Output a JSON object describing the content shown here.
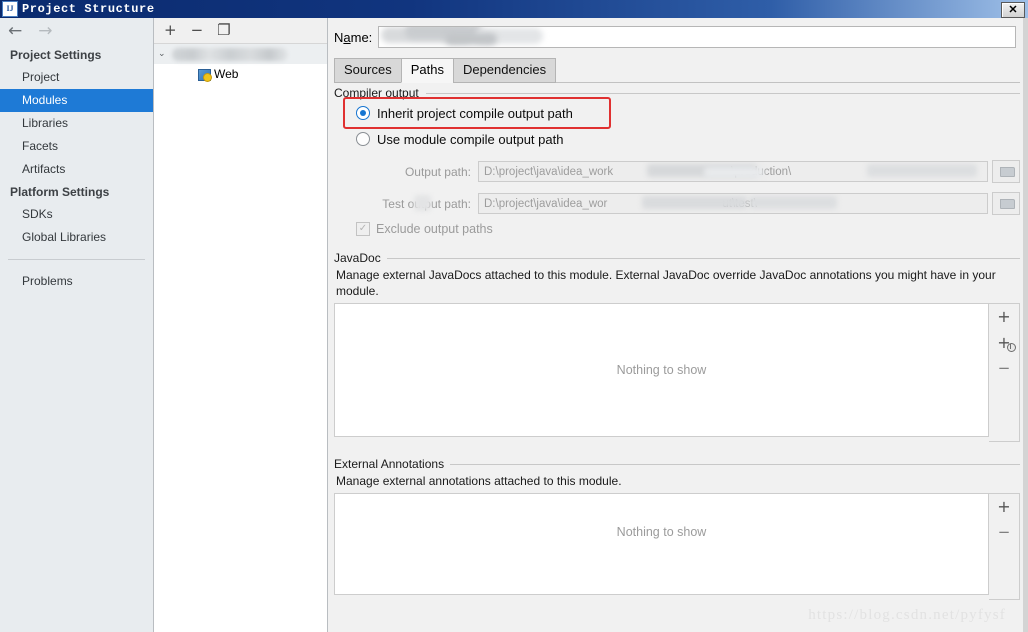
{
  "window": {
    "title": "Project Structure",
    "app_icon_text": "IJ",
    "close_label": "✕"
  },
  "sidebar": {
    "back_arrow": "←",
    "forward_arrow": "→",
    "groups": [
      {
        "title": "Project Settings",
        "items": [
          {
            "label": "Project",
            "selected": false
          },
          {
            "label": "Modules",
            "selected": true
          },
          {
            "label": "Libraries",
            "selected": false
          },
          {
            "label": "Facets",
            "selected": false
          },
          {
            "label": "Artifacts",
            "selected": false
          }
        ]
      },
      {
        "title": "Platform Settings",
        "items": [
          {
            "label": "SDKs",
            "selected": false
          },
          {
            "label": "Global Libraries",
            "selected": false
          }
        ]
      }
    ],
    "footer_item": "Problems"
  },
  "tree": {
    "toolbar": {
      "add": "+",
      "remove": "−",
      "copy": "❐"
    },
    "module_row": {
      "chevron": "⌄",
      "name_redacted": true
    },
    "child_row": {
      "label": "Web"
    }
  },
  "main": {
    "name_field": {
      "label_prefix": "N",
      "label_mnemonic": "a",
      "label_suffix": "me:",
      "value_redacted": true,
      "value": ""
    },
    "tabs": [
      {
        "label": "Sources",
        "active": false
      },
      {
        "label": "Paths",
        "active": true
      },
      {
        "label": "Dependencies",
        "active": false
      }
    ],
    "compiler_output": {
      "legend": "Compiler output",
      "radios": [
        {
          "label": "Inherit project compile output path",
          "checked": true,
          "highlighted": true
        },
        {
          "label": "Use module compile output path",
          "checked": false,
          "highlighted": false
        }
      ],
      "output_path": {
        "label": "Output path:",
        "value_visible_start": "D:\\project\\java\\idea_work",
        "value_visible_mid": "\\production\\",
        "redacted": true
      },
      "test_output_path": {
        "label": "Test output path:",
        "value_visible_start": "D:\\project\\java\\idea_wor",
        "value_visible_mid": "ut\\test\\",
        "redacted": true
      },
      "exclude_checkbox": {
        "label": "Exclude output paths",
        "checked": true,
        "enabled": false
      },
      "browse_icon": "folder-icon"
    },
    "javadoc": {
      "legend": "JavaDoc",
      "description": "Manage external JavaDocs attached to this module. External JavaDoc override JavaDoc annotations you might have in your module.",
      "empty_text": "Nothing to show",
      "buttons": [
        {
          "name": "add",
          "glyph": "+"
        },
        {
          "name": "add-url",
          "glyph": "+"
        },
        {
          "name": "remove",
          "glyph": "−"
        }
      ]
    },
    "external_annotations": {
      "legend": "External Annotations",
      "description": "Manage external annotations attached to this module.",
      "empty_text": "Nothing to show",
      "buttons": [
        {
          "name": "add",
          "glyph": "+"
        },
        {
          "name": "remove",
          "glyph": "−"
        }
      ]
    }
  },
  "watermark": "https://blog.csdn.net/pyfysf",
  "colors": {
    "accent_selection": "#1e7ad6",
    "highlight_red": "#e03131",
    "titlebar_start": "#0a2a6e",
    "sidebar_bg": "#e8ecef",
    "content_bg": "#f1f1f1"
  }
}
